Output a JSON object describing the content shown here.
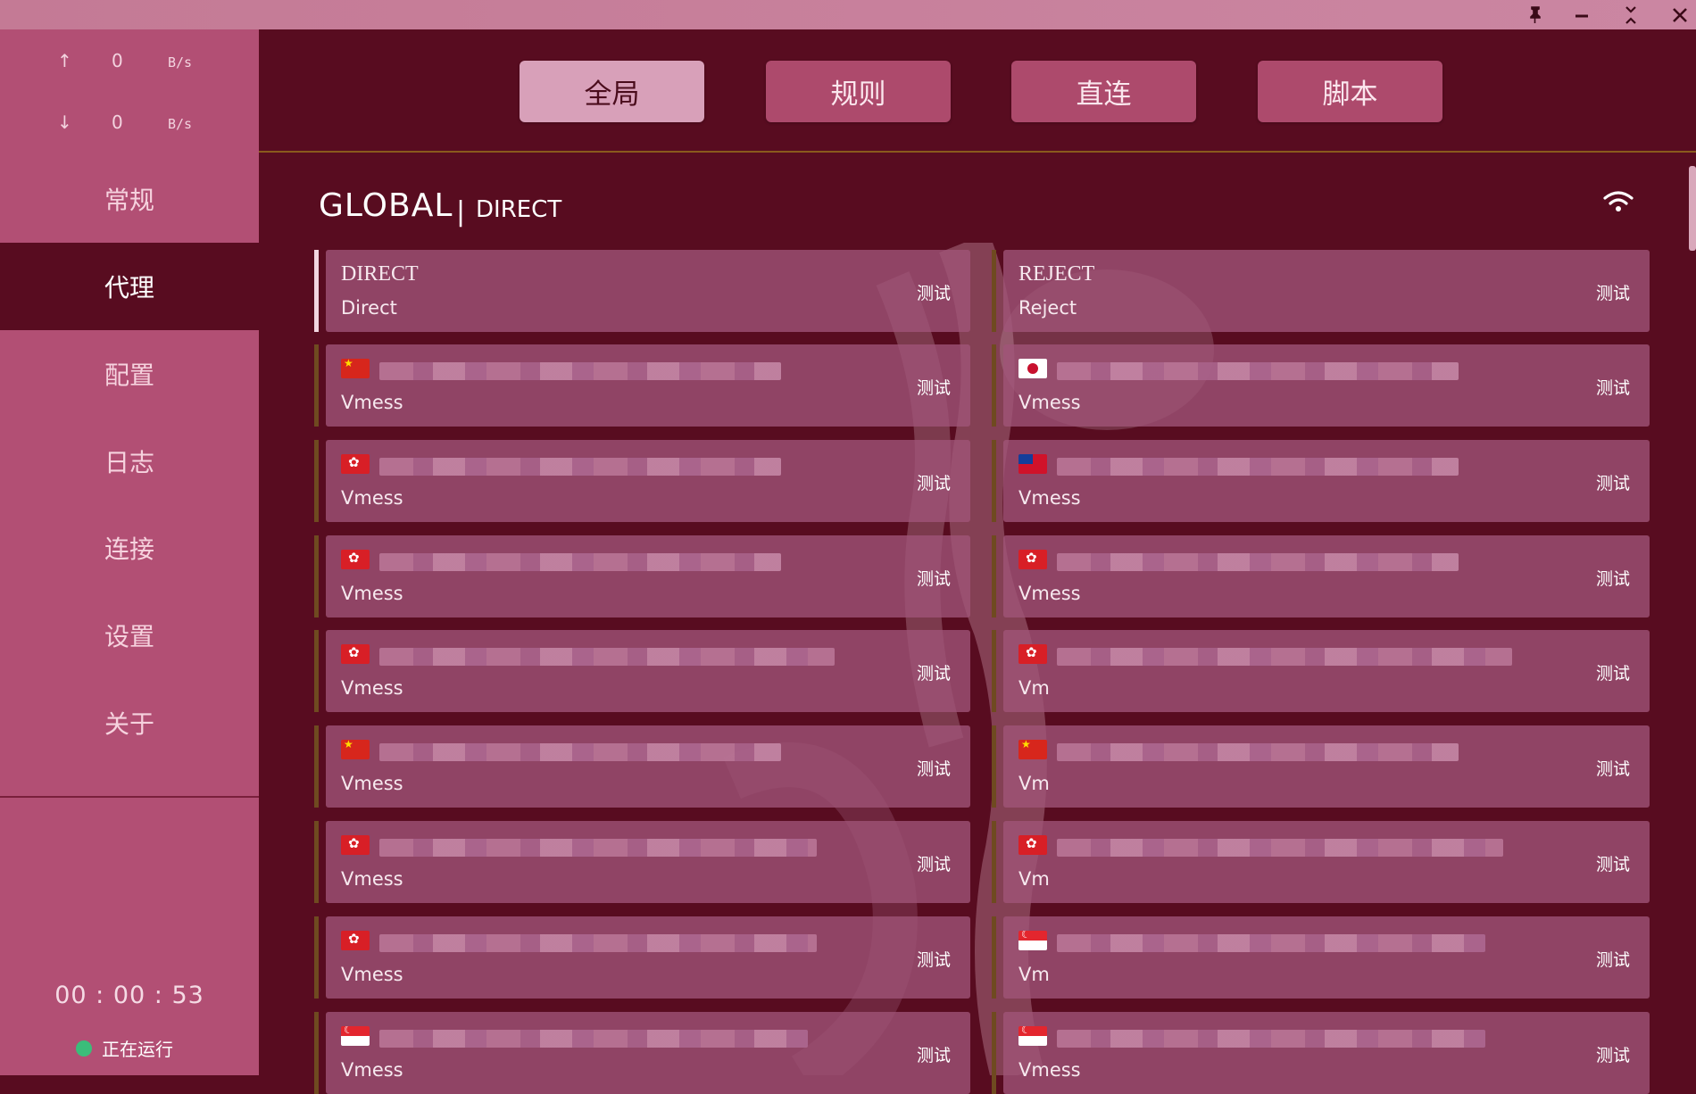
{
  "window": {
    "pin_icon": "pin-icon",
    "minimize_icon": "minimize-icon",
    "restore_icon": "restore-icon",
    "close_icon": "close-icon"
  },
  "traffic": {
    "up_arrow": "↑",
    "up_value": "0",
    "up_unit": "B/s",
    "down_arrow": "↓",
    "down_value": "0",
    "down_unit": "B/s"
  },
  "nav": {
    "items": [
      {
        "label": "常规"
      },
      {
        "label": "代理"
      },
      {
        "label": "配置"
      },
      {
        "label": "日志"
      },
      {
        "label": "连接"
      },
      {
        "label": "设置"
      },
      {
        "label": "关于"
      }
    ],
    "active": "代理"
  },
  "footer": {
    "uptime": "00 : 00 : 53",
    "status": "正在运行",
    "status_color": "#3bbd7a"
  },
  "modes": [
    {
      "label": "全局"
    },
    {
      "label": "规则"
    },
    {
      "label": "直连"
    },
    {
      "label": "脚本"
    }
  ],
  "active_mode": "全局",
  "group": {
    "title": "GLOBAL",
    "separator": "|",
    "selected": "DIRECT",
    "latency_icon": "wifi-icon"
  },
  "test_label": "测试",
  "proxies_left": [
    {
      "name": "DIRECT",
      "type": "Direct",
      "flag": "",
      "selected": true
    },
    {
      "name": "",
      "type": "Vmess",
      "flag": "cn"
    },
    {
      "name": "",
      "type": "Vmess",
      "flag": "hk"
    },
    {
      "name": "",
      "type": "Vmess",
      "flag": "hk"
    },
    {
      "name": "",
      "type": "Vmess",
      "flag": "hk"
    },
    {
      "name": "",
      "type": "Vmess",
      "flag": "cn"
    },
    {
      "name": "",
      "type": "Vmess",
      "flag": "hk"
    },
    {
      "name": "",
      "type": "Vmess",
      "flag": "hk"
    },
    {
      "name": "",
      "type": "Vmess",
      "flag": "sg"
    }
  ],
  "proxies_right": [
    {
      "name": "REJECT",
      "type": "Reject",
      "flag": ""
    },
    {
      "name": "",
      "type": "Vmess",
      "flag": "jp"
    },
    {
      "name": "",
      "type": "Vmess",
      "flag": "tw"
    },
    {
      "name": "",
      "type": "Vmess",
      "flag": "hk"
    },
    {
      "name": "",
      "type": "Vm",
      "flag": "hk"
    },
    {
      "name": "",
      "type": "Vm",
      "flag": "cn"
    },
    {
      "name": "",
      "type": "Vm",
      "flag": "hk"
    },
    {
      "name": "",
      "type": "Vm",
      "flag": "sg"
    },
    {
      "name": "",
      "type": "Vmess",
      "flag": "sg"
    }
  ]
}
